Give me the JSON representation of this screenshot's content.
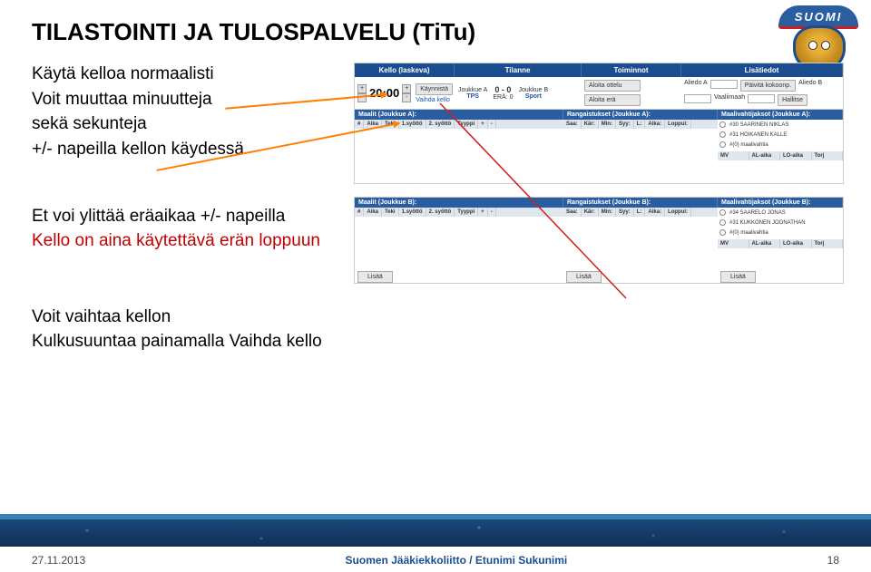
{
  "title": "TILASTOINTI JA TULOSPALVELU (TiTu)",
  "logo_text": "SUOMI",
  "bullets": {
    "b1": "Käytä kelloa normaalisti",
    "b2": "Voit muuttaa minuutteja",
    "b3a": "sekä sekunteja",
    "b3b": "+/- napeilla kellon käydessä",
    "b4": "Et voi ylittää eräaikaa +/- napeilla",
    "b5": "Kello on aina käytettävä erän loppuun",
    "b6": "Voit vaihtaa kellon",
    "b7": "Kulkusuuntaa painamalla  Vaihda kello"
  },
  "shot": {
    "hdr": {
      "kello": "Kello (laskeva)",
      "tilanne": "Tilanne",
      "toiminnot": "Toiminnot",
      "lisatiedot": "Lisätiedot"
    },
    "clock": {
      "time": "20:00",
      "kaynnista": "Käynnistä",
      "vaihda": "Vaihda kello"
    },
    "tilanne": {
      "teamA_lbl": "Joukkue A",
      "teamB_lbl": "Joukkue B",
      "teamA": "TPS",
      "teamB": "Sport",
      "score": "0 - 0",
      "era": "ERÄ: 0"
    },
    "toiminnot": {
      "aloita": "Aloita ottelu",
      "aloita_era": "Aloita erä"
    },
    "lisatiedot": {
      "aliedo_a": "Aliedo A",
      "aliedo_b": "Aliedo B",
      "vaaliimaah": "Vaaliimaah",
      "paivita": "Päivitä kokoonp.",
      "hallitse": "Hallitse"
    },
    "sectionA": {
      "maalit": "Maalit (Joukkue A):",
      "rangaistukset": "Rangaistukset (Joukkue A):",
      "mv": "Maalivahtijaksot (Joukkue A):"
    },
    "sectionB": {
      "maalit": "Maalit (Joukkue B):",
      "rangaistukset": "Rangaistukset (Joukkue B):",
      "mv": "Maalivahtijaksot (Joukkue B):"
    },
    "tbl_maalit": [
      "#",
      "Aika",
      "Teki",
      "1.syöttö",
      "2. syöttö",
      "Tyyppi",
      "+",
      "-"
    ],
    "tbl_rangaistukset": [
      "Saa:",
      "Kär:",
      "Min:",
      "Syy:",
      "L:",
      "Aika:",
      "Loppui:"
    ],
    "goalies_a": [
      "#30 SAARINEN NIKLAS",
      "#31 HOIKANEN KALLE",
      "#(0) maalivahtia"
    ],
    "goalies_b": [
      "#34 SAARELO JONAS",
      "#31 KUKKONEN JOONATHAN",
      "#(0) maalivahtia"
    ],
    "mv_cols": [
      "MV",
      "AL-aika",
      "LO-aika",
      "Torj"
    ],
    "lisaa": "Lisää"
  },
  "footer": {
    "date": "27.11.2013",
    "center": "Suomen Jääkiekkoliitto / Etunimi Sukunimi",
    "page": "18"
  }
}
